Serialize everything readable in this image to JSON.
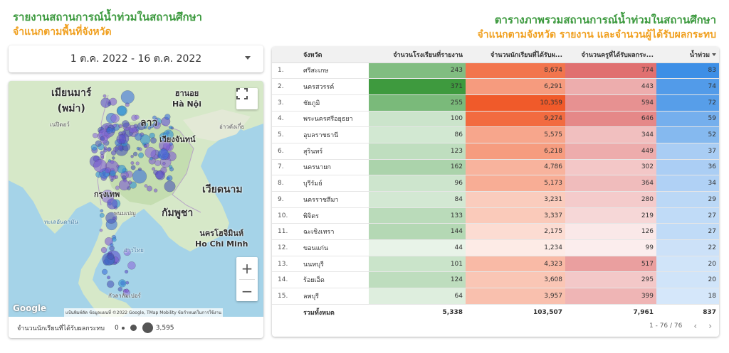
{
  "left_title": {
    "line1": "รายงานสถานการณ์น้ำท่วมในสถานศึกษา",
    "line2": "จำแนกตามพื้นที่จังหวัด"
  },
  "right_title": {
    "line1": "ตารางภาพรวมสถานการณ์น้ำท่วมในสถานศึกษา",
    "line2": "จำแนกตามจังหวัด รายงาน และจำนวนผู้ได้รับผลกระทบ"
  },
  "date_range": {
    "value": "1 ต.ค. 2022 - 16 ต.ค. 2022"
  },
  "map": {
    "labels": {
      "myanmar": "เมียนมาร์\n(พม่า)",
      "hanoi": "ฮานอย\nHà Nội",
      "laos": "ลาว",
      "naypyidaw": "เนปิดอว์",
      "vientiane": "เวียงจันทน์",
      "gulf_tonkin": "อ่าวตังเกี๋ย",
      "bangkok": "กรุงเทพ",
      "vietnam": "เวียดนาม",
      "cambodia": "กัมพูชา",
      "phnom_penh": "พนมเปญ",
      "hcmc": "นครโฮจิมินห์\nHo Chi Minh",
      "andaman": "ทะเลอันดามัน",
      "gulf_thailand": "อ่าวไทย",
      "kl": "กัวลาลัมเปอร์"
    },
    "google": "Google",
    "attribution": "แป้นพิมพ์ลัด   ข้อมูลแผนที่ ©2022 Google, TMap Mobility   ข้อกำหนดในการใช้งาน",
    "legend_label": "จำนวนนักเรียนที่ได้รับผลกระทบ",
    "legend_min": "0",
    "legend_max": "3,595",
    "zoom_in": "+",
    "zoom_out": "−"
  },
  "table": {
    "headers": {
      "province": "จังหวัด",
      "schools": "จำนวนโรงเรียนที่รายงาน",
      "students": "จำนวนนักเรียนที่ได้รับผ...",
      "teachers": "จำนวนครูที่ได้รับผลกระ...",
      "flood": "น้ำท่วม"
    },
    "rows": [
      {
        "idx": "1.",
        "province": "ศรีสะเกษ",
        "schools": "243",
        "students": "8,674",
        "teachers": "774",
        "flood": "83"
      },
      {
        "idx": "2.",
        "province": "นครสวรรค์",
        "schools": "371",
        "students": "6,291",
        "teachers": "443",
        "flood": "74"
      },
      {
        "idx": "3.",
        "province": "ชัยภูมิ",
        "schools": "255",
        "students": "10,359",
        "teachers": "594",
        "flood": "72"
      },
      {
        "idx": "4.",
        "province": "พระนครศรีอยุธยา",
        "schools": "100",
        "students": "9,274",
        "teachers": "646",
        "flood": "59"
      },
      {
        "idx": "5.",
        "province": "อุบลราชธานี",
        "schools": "86",
        "students": "5,575",
        "teachers": "344",
        "flood": "52"
      },
      {
        "idx": "6.",
        "province": "สุรินทร์",
        "schools": "123",
        "students": "6,218",
        "teachers": "449",
        "flood": "37"
      },
      {
        "idx": "7.",
        "province": "นครนายก",
        "schools": "162",
        "students": "4,786",
        "teachers": "302",
        "flood": "36"
      },
      {
        "idx": "8.",
        "province": "บุรีรัมย์",
        "schools": "96",
        "students": "5,173",
        "teachers": "364",
        "flood": "34"
      },
      {
        "idx": "9.",
        "province": "นครราชสีมา",
        "schools": "84",
        "students": "3,231",
        "teachers": "280",
        "flood": "29"
      },
      {
        "idx": "10.",
        "province": "พิจิตร",
        "schools": "133",
        "students": "3,337",
        "teachers": "219",
        "flood": "27"
      },
      {
        "idx": "11.",
        "province": "ฉะเชิงเทรา",
        "schools": "144",
        "students": "2,175",
        "teachers": "126",
        "flood": "27"
      },
      {
        "idx": "12.",
        "province": "ขอนแก่น",
        "schools": "44",
        "students": "1,234",
        "teachers": "99",
        "flood": "22"
      },
      {
        "idx": "13.",
        "province": "นนทบุรี",
        "schools": "101",
        "students": "4,323",
        "teachers": "517",
        "flood": "20"
      },
      {
        "idx": "14.",
        "province": "ร้อยเอ็ด",
        "schools": "124",
        "students": "3,608",
        "teachers": "295",
        "flood": "20"
      },
      {
        "idx": "15.",
        "province": "ลพบุรี",
        "schools": "64",
        "students": "3,957",
        "teachers": "399",
        "flood": "18"
      }
    ],
    "total": {
      "label": "รวมทั้งหมด",
      "schools": "5,338",
      "students": "103,507",
      "teachers": "7,961",
      "flood": "837"
    },
    "pager": "1 - 76 / 76"
  },
  "colors": {
    "green_title": "#3d9a3f",
    "orange_title": "#f0a020"
  }
}
